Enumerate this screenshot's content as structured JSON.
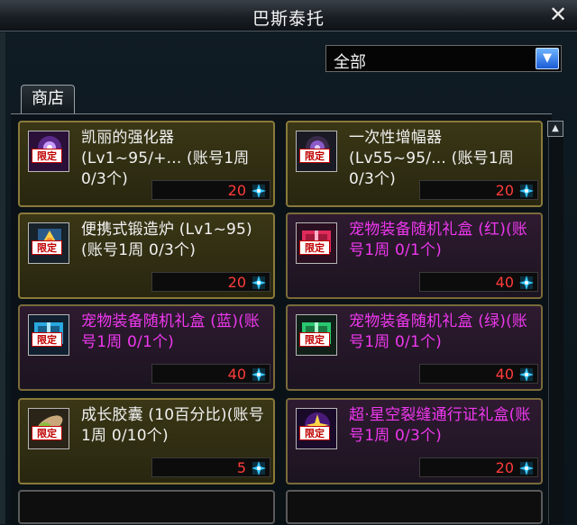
{
  "window": {
    "title": "巴斯泰托",
    "close_glyph": "✕"
  },
  "filter": {
    "selected": "全部",
    "arrow_glyph": "▼"
  },
  "tabs": [
    {
      "label": "商店"
    }
  ],
  "scroll": {
    "up_glyph": "▲"
  },
  "badge_text": "限定",
  "items": [
    {
      "name": "凯丽的强化器 (Lv1~95/+... (账号1周 0/3个)",
      "price": "20",
      "color": "white",
      "icon": "purple-orb-icon"
    },
    {
      "name": "一次性增幅器 (Lv55~95/... (账号1周 0/3个)",
      "price": "20",
      "color": "white",
      "icon": "dark-orb-icon"
    },
    {
      "name": "便携式锻造炉 (Lv1~95)(账号1周 0/3个)",
      "price": "20",
      "color": "white",
      "icon": "forge-icon"
    },
    {
      "name": "宠物装备随机礼盒 (红)(账号1周 0/1个)",
      "price": "40",
      "color": "pink",
      "icon": "red-gift-box-icon"
    },
    {
      "name": "宠物装备随机礼盒 (蓝)(账号1周 0/1个)",
      "price": "40",
      "color": "pink",
      "icon": "blue-gift-box-icon"
    },
    {
      "name": "宠物装备随机礼盒 (绿)(账号1周 0/1个)",
      "price": "40",
      "color": "pink",
      "icon": "green-gift-box-icon"
    },
    {
      "name": "成长胶囊 (10百分比)(账号1周 0/10个)",
      "price": "5",
      "color": "white",
      "icon": "capsule-icon"
    },
    {
      "name": "超·星空裂缝通行证礼盒(账号1周 0/3个)",
      "price": "20",
      "color": "pink",
      "icon": "starry-pass-icon"
    }
  ],
  "colors": {
    "price": "#ff3b3b",
    "pink_text": "#ee38ee",
    "currency_gem": "#38c8ff"
  },
  "currency_icon": "cyan-crystal-icon"
}
